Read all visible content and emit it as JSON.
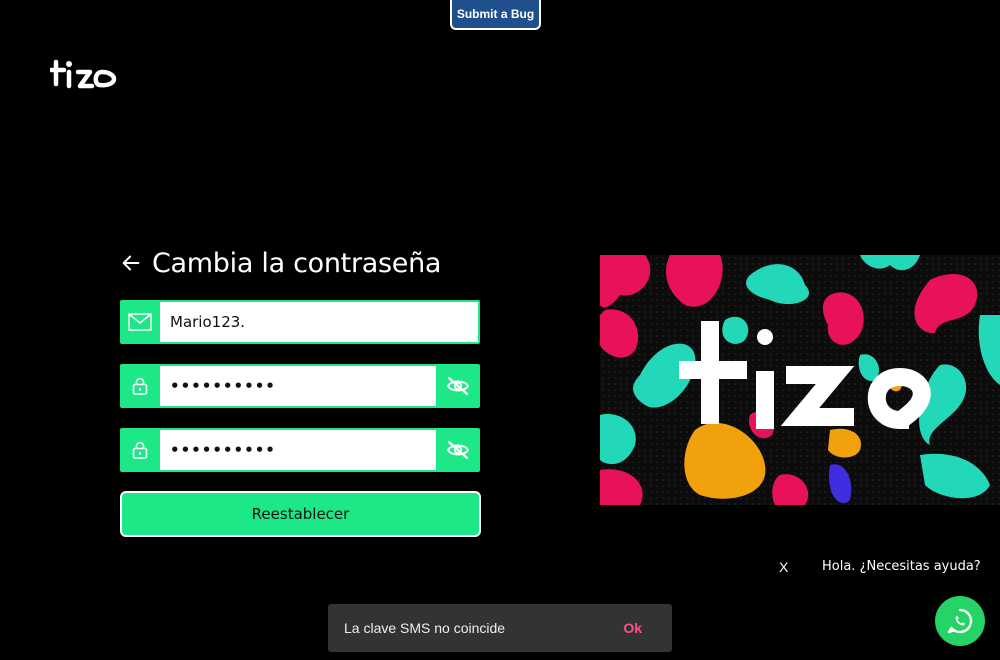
{
  "bug_button": {
    "label": "Submit a Bug"
  },
  "header": {
    "logo": "tizo-logo"
  },
  "form": {
    "title": "Cambia la contraseña",
    "username": {
      "value": "Mario123.",
      "icon": "envelope-icon"
    },
    "password": {
      "value": "••••••••••",
      "icon": "lock-icon",
      "toggle_icon": "eye-slash-icon"
    },
    "confirm_password": {
      "value": "••••••••••",
      "icon": "lock-icon",
      "toggle_icon": "eye-slash-icon"
    },
    "submit_label": "Reestablecer"
  },
  "chat": {
    "close_label": "X",
    "help_text": "Hola. ¿Necesitas ayuda?",
    "icon": "whatsapp-icon"
  },
  "toast": {
    "message": "La clave SMS no coincide",
    "action": "Ok"
  },
  "colors": {
    "accent": "#1de887",
    "background": "#000000",
    "toast_action": "#ff4f8b",
    "bug_button": "#1f4f8c"
  }
}
